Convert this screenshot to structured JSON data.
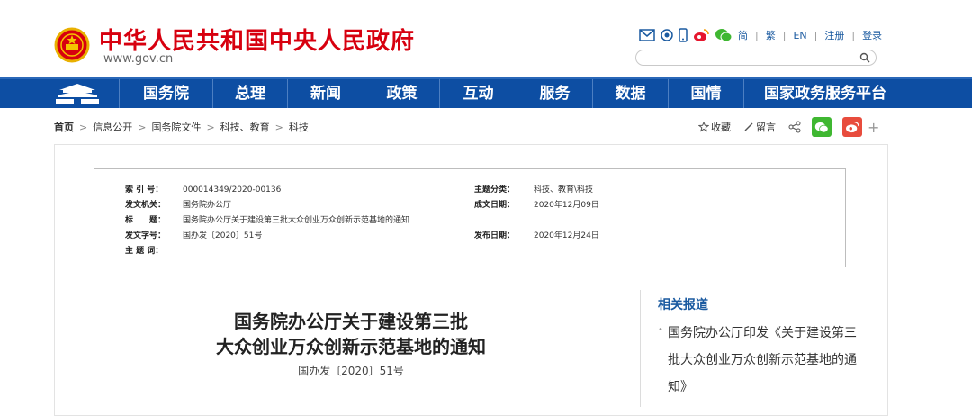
{
  "header": {
    "site_title": "中华人民共和国中央人民政府",
    "site_url": "www.gov.cn",
    "lang_links": [
      "简",
      "繁",
      "EN",
      "注册",
      "登录"
    ]
  },
  "nav": {
    "items": [
      "国务院",
      "总理",
      "新闻",
      "政策",
      "互动",
      "服务",
      "数据",
      "国情",
      "国家政务服务平台"
    ]
  },
  "breadcrumb": {
    "home": "首页",
    "items": [
      "信息公开",
      "国务院文件",
      "科技、教育",
      "科技"
    ],
    "sep": ">"
  },
  "share": {
    "favorite": "收藏",
    "comment": "留言"
  },
  "meta": {
    "index_label": "索 引 号：",
    "index_value": "000014349/2020-00136",
    "issuer_label": "发文机关：",
    "issuer_value": "国务院办公厅",
    "title_label": "标　　题：",
    "title_value": "国务院办公厅关于建设第三批大众创业万众创新示范基地的通知",
    "docnum_label": "发文字号：",
    "docnum_value": "国办发〔2020〕51号",
    "keywords_label": "主 题 词：",
    "category_label": "主题分类：",
    "category_value": "科技、教育\\科技",
    "written_label": "成文日期：",
    "written_value": "2020年12月09日",
    "published_label": "发布日期：",
    "published_value": "2020年12月24日"
  },
  "article": {
    "title_line1": "国务院办公厅关于建设第三批",
    "title_line2": "大众创业万众创新示范基地的通知",
    "doc_number": "国办发〔2020〕51号"
  },
  "sidebar": {
    "heading": "相关报道",
    "bullet": "•",
    "related": "国务院办公厅印发《关于建设第三批大众创业万众创新示范基地的通知》"
  },
  "colors": {
    "brand_red": "#d7000f",
    "nav_blue": "#0d4ea3",
    "link_blue": "#1a5aa0"
  }
}
